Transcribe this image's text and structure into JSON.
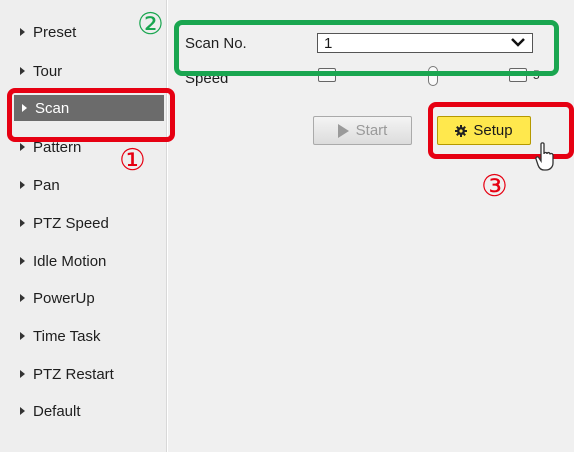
{
  "sidebar": {
    "items": [
      {
        "label": "Preset"
      },
      {
        "label": "Tour"
      },
      {
        "label": "Scan"
      },
      {
        "label": "Pattern"
      },
      {
        "label": "Pan"
      },
      {
        "label": "PTZ Speed"
      },
      {
        "label": "Idle Motion"
      },
      {
        "label": "PowerUp"
      },
      {
        "label": "Time Task"
      },
      {
        "label": "PTZ Restart"
      },
      {
        "label": "Default"
      }
    ],
    "active": "Scan"
  },
  "main": {
    "scan_no_label": "Scan No.",
    "scan_no_value": "1",
    "speed_label": "Speed",
    "speed_value": "5",
    "start_label": "Start",
    "setup_label": "Setup"
  },
  "annotations": {
    "step1": "①",
    "step2": "②",
    "step3": "③",
    "colors": {
      "red": "#e60012",
      "green": "#1aa650",
      "setup_button": "#ffe84d"
    }
  },
  "icons": [
    "play-icon",
    "gear-icon",
    "chevron-down-icon",
    "hand-cursor-icon"
  ]
}
